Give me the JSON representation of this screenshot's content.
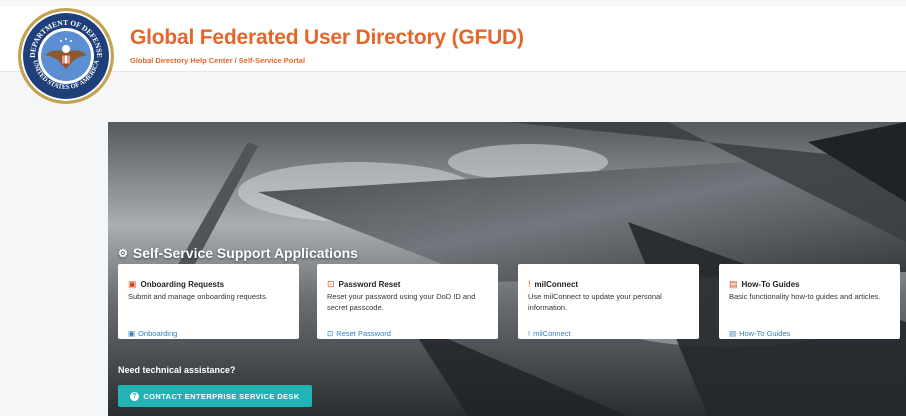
{
  "header": {
    "title": "Global Federated User Directory (GFUD)",
    "subtitle": "Global Directory Help Center / Self-Service Portal",
    "seal_text_top": "DEPARTMENT OF DEFENSE",
    "seal_text_bottom": "UNITED STATES OF AMERICA"
  },
  "hero": {
    "section_title": "Self-Service Support Applications",
    "cards": [
      {
        "icon": "onboarding-icon",
        "title": "Onboarding Requests",
        "description": "Submit and manage onboarding requests.",
        "link_label": "Onboarding"
      },
      {
        "icon": "lock-icon",
        "title": "Password Reset",
        "description": "Reset your password using your DoD ID and secret passcode.",
        "link_label": "Reset Password"
      },
      {
        "icon": "milconnect-icon",
        "title": "milConnect",
        "description": "Use milConnect to update your personal information.",
        "link_label": "milConnect"
      },
      {
        "icon": "guide-icon",
        "title": "How-To Guides",
        "description": "Basic functionality how-to guides and articles.",
        "link_label": "How-To Guides"
      }
    ],
    "assist_text": "Need technical assistance?",
    "cta_label": "CONTACT ENTERPRISE SERVICE DESK"
  },
  "colors": {
    "accent": "#e3672b",
    "link": "#2f7fc4",
    "cta": "#24b3b5",
    "icon": "#d9481f"
  }
}
